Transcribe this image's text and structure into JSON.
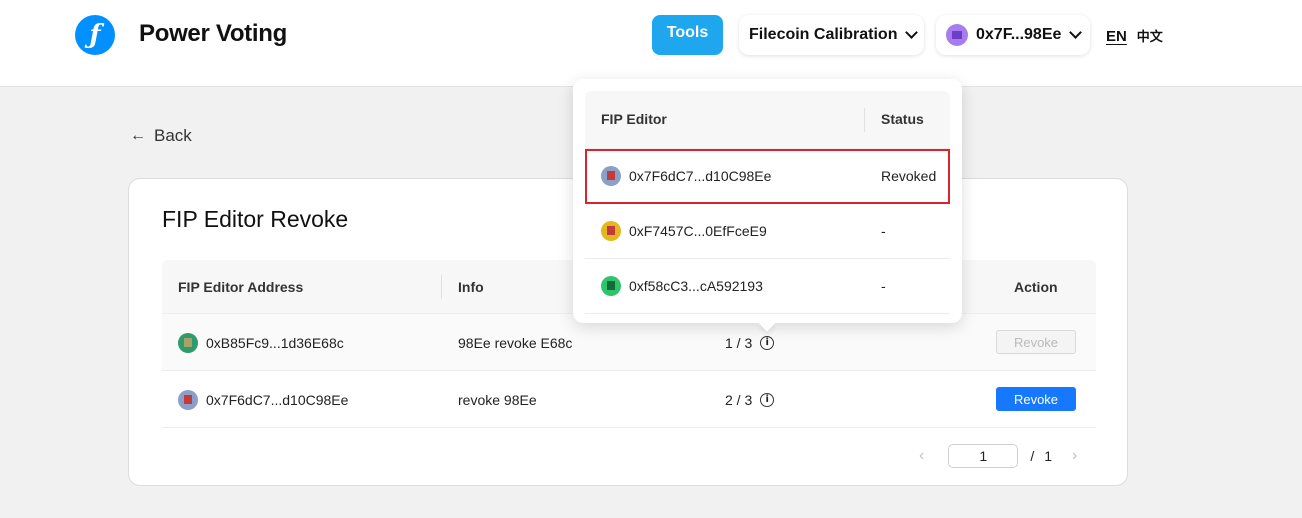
{
  "header": {
    "app_title": "Power Voting",
    "tools_label": "Tools",
    "network": "Filecoin Calibration",
    "account": "0x7F...98Ee",
    "lang_en": "EN",
    "lang_zh": "中文"
  },
  "back": {
    "label": "Back"
  },
  "card": {
    "title": "FIP Editor Revoke",
    "columns": {
      "address": "FIP Editor Address",
      "info": "Info",
      "action": "Action"
    },
    "rows": [
      {
        "address": "0xB85Fc9...1d36E68c",
        "info": "98Ee revoke E68c",
        "count": "1 / 3",
        "action": "Revoke",
        "action_enabled": false
      },
      {
        "address": "0x7F6dC7...d10C98Ee",
        "info": "revoke 98Ee",
        "count": "2 / 3",
        "action": "Revoke",
        "action_enabled": true
      }
    ],
    "pagination": {
      "current": "1",
      "separator": "/",
      "total": "1"
    }
  },
  "popover": {
    "columns": {
      "editor": "FIP Editor",
      "status": "Status"
    },
    "rows": [
      {
        "editor": "0x7F6dC7...d10C98Ee",
        "status": "Revoked",
        "highlighted": true
      },
      {
        "editor": "0xF7457C...0EfFceE9",
        "status": "-"
      },
      {
        "editor": "0xf58cC3...cA592193",
        "status": "-"
      }
    ]
  },
  "colors": {
    "accent": "#1677ff",
    "tools": "#1ea7ef",
    "highlight": "#d9232d",
    "logo": "#0090ff"
  },
  "icons": [
    "filecoin-logo-icon",
    "chevron-down-icon",
    "avatar-icon",
    "arrow-left-icon",
    "info-icon",
    "chevron-left-icon",
    "chevron-right-icon"
  ]
}
